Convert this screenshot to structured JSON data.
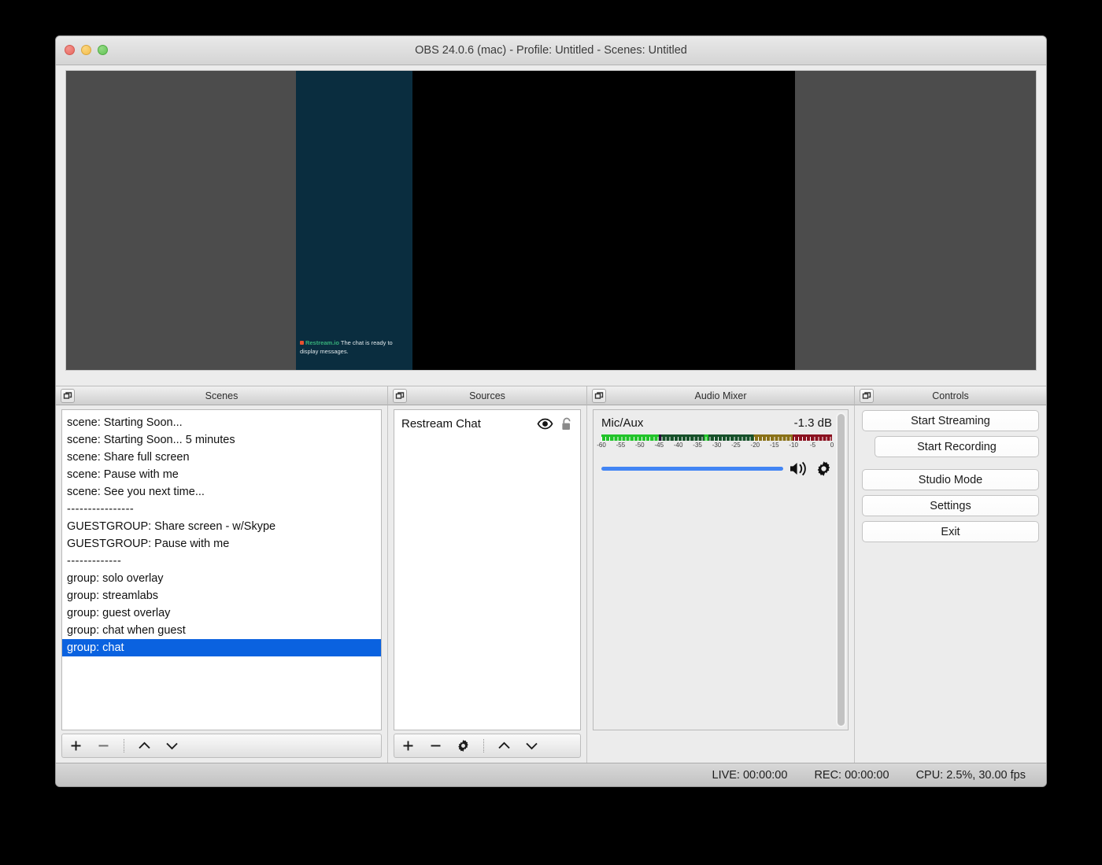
{
  "window": {
    "title": "OBS 24.0.6 (mac) - Profile: Untitled - Scenes: Untitled",
    "traffic_lights": [
      "close-red",
      "minimize-yellow",
      "maximize-green"
    ]
  },
  "preview": {
    "background_color": "#4c4c4c",
    "canvas_color": "#000000",
    "chat_panel_color": "#0a2d3f",
    "chat_overlay": {
      "brand": "Restream.io",
      "message": "The chat is ready to display messages.",
      "brand_color": "#37b07a",
      "dot_color": "#e8502f"
    }
  },
  "docks": [
    {
      "label": "Scenes"
    },
    {
      "label": "Sources"
    },
    {
      "label": "Audio Mixer"
    },
    {
      "label": "Controls"
    }
  ],
  "scenes": {
    "items": [
      {
        "label": "scene: Starting Soon...",
        "selected": false,
        "separator": false
      },
      {
        "label": "scene: Starting Soon... 5 minutes",
        "selected": false,
        "separator": false
      },
      {
        "label": "scene: Share full screen",
        "selected": false,
        "separator": false
      },
      {
        "label": "scene: Pause with me",
        "selected": false,
        "separator": false
      },
      {
        "label": "scene: See you next time...",
        "selected": false,
        "separator": false
      },
      {
        "label": "----------------",
        "selected": false,
        "separator": true
      },
      {
        "label": "GUESTGROUP: Share screen - w/Skype",
        "selected": false,
        "separator": false
      },
      {
        "label": "GUESTGROUP: Pause with me",
        "selected": false,
        "separator": false
      },
      {
        "label": "-------------",
        "selected": false,
        "separator": true
      },
      {
        "label": "group: solo overlay",
        "selected": false,
        "separator": false
      },
      {
        "label": "group: streamlabs",
        "selected": false,
        "separator": false
      },
      {
        "label": "group: guest overlay",
        "selected": false,
        "separator": false
      },
      {
        "label": "group: chat when guest",
        "selected": false,
        "separator": false
      },
      {
        "label": "group: chat",
        "selected": true,
        "separator": false
      }
    ],
    "selection_color": "#0a62e0",
    "toolbar": [
      {
        "icon": "plus-icon"
      },
      {
        "icon": "minus-icon"
      },
      {
        "icon": "separator"
      },
      {
        "icon": "chevron-up-icon"
      },
      {
        "icon": "chevron-down-icon"
      }
    ]
  },
  "sources": {
    "items": [
      {
        "label": "Restream Chat",
        "visible": true,
        "locked": false
      }
    ],
    "toolbar": [
      {
        "icon": "plus-icon"
      },
      {
        "icon": "minus-icon"
      },
      {
        "icon": "gear-icon"
      },
      {
        "icon": "separator"
      },
      {
        "icon": "chevron-up-icon"
      },
      {
        "icon": "chevron-down-icon"
      }
    ]
  },
  "audio_mixer": {
    "tracks": [
      {
        "name": "Mic/Aux",
        "db": "-1.3 dB",
        "meter_fill_percent": 66,
        "fader_percent": 88,
        "tick_labels": [
          "-60",
          "-55",
          "-50",
          "-45",
          "-40",
          "-35",
          "-30",
          "-25",
          "-20",
          "-15",
          "-10",
          "-5",
          "0"
        ],
        "meter_colors": {
          "green": "#22c32a",
          "dark_green": "#17512a",
          "olive": "#8a7118",
          "dark_red": "#8b1220"
        },
        "fader_color": "#4285f4",
        "icons": [
          "speaker-icon",
          "gear-icon"
        ]
      }
    ]
  },
  "controls": {
    "buttons": [
      {
        "label": "Start Streaming",
        "indent": false
      },
      {
        "label": "Start Recording",
        "indent": true
      },
      {
        "label": "Studio Mode",
        "indent": false
      },
      {
        "label": "Settings",
        "indent": false
      },
      {
        "label": "Exit",
        "indent": false
      }
    ]
  },
  "statusbar": {
    "live": "LIVE: 00:00:00",
    "rec": "REC: 00:00:00",
    "cpu": "CPU: 2.5%, 30.00 fps"
  }
}
